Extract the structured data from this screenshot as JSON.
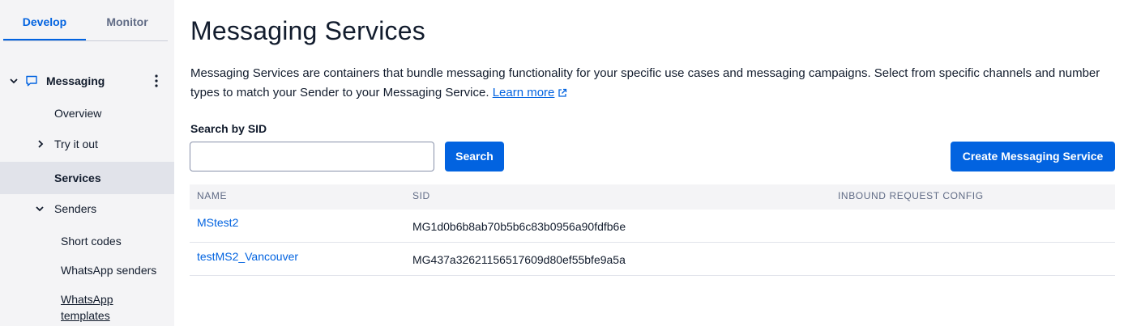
{
  "sidebar": {
    "tabs": {
      "develop": "Develop",
      "monitor": "Monitor"
    },
    "items": {
      "messaging": "Messaging",
      "overview": "Overview",
      "try_it_out": "Try it out",
      "services": "Services",
      "senders": "Senders",
      "short_codes": "Short codes",
      "whatsapp_senders": "WhatsApp senders",
      "whatsapp_templates": "WhatsApp templates"
    }
  },
  "main": {
    "title": "Messaging Services",
    "description": "Messaging Services are containers that bundle messaging functionality for your specific use cases and messaging campaigns. Select from specific channels and number types to match your Sender to your Messaging Service.",
    "learn_more": "Learn more",
    "search_label": "Search by SID",
    "search_value": "",
    "search_button": "Search",
    "create_button": "Create Messaging Service"
  },
  "table": {
    "headers": {
      "name": "NAME",
      "sid": "SID",
      "inbound": "INBOUND REQUEST CONFIG"
    },
    "rows": [
      {
        "name": "MStest2",
        "sid": "MG1d0b6b8ab70b5b6c83b0956a90fdfb6e",
        "inbound": ""
      },
      {
        "name": "testMS2_Vancouver",
        "sid": "MG437a32621156517609d80ef55bfe9a5a",
        "inbound": ""
      }
    ]
  },
  "colors": {
    "accent": "#0263e0",
    "sidebar_bg": "#f4f4f6",
    "selected_bg": "#e1e3ea",
    "text": "#121c2d",
    "muted": "#606b85"
  }
}
